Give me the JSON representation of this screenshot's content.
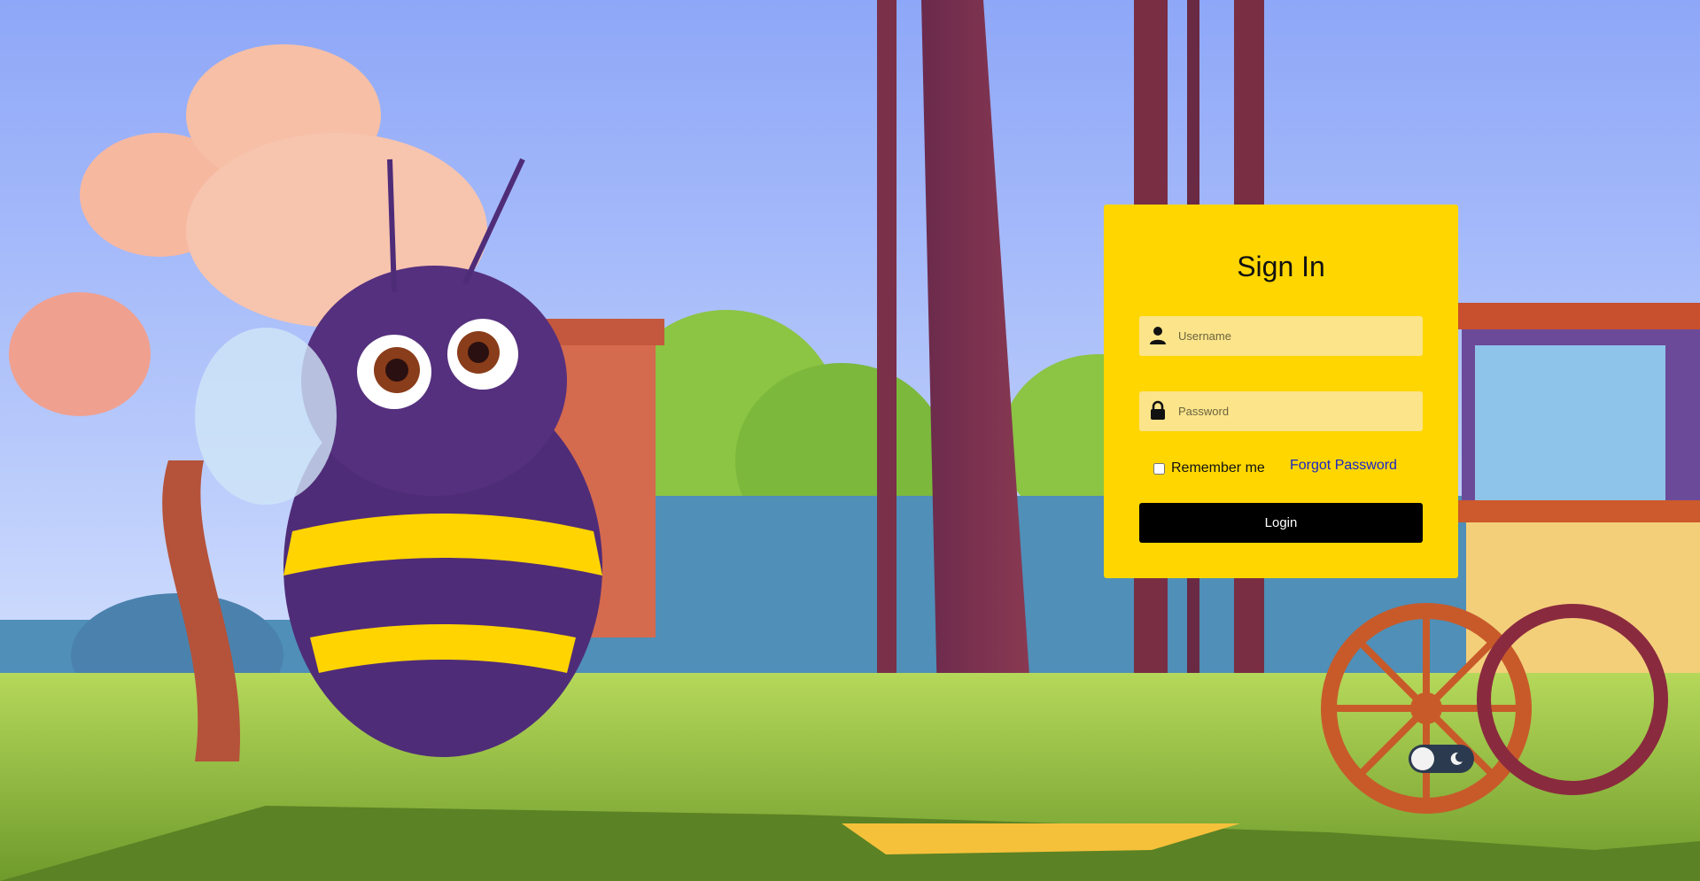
{
  "login": {
    "title": "Sign In",
    "username_placeholder": "Username",
    "password_placeholder": "Password",
    "remember_label": "Remember me",
    "forgot_label": "Forgot Password",
    "login_label": "Login"
  },
  "icons": {
    "user": "user-icon",
    "lock": "lock-icon",
    "theme": "moon-icon"
  },
  "colors": {
    "card": "#ffd600",
    "input": "#fce48a",
    "button": "#000000",
    "link": "#1a25c9"
  }
}
